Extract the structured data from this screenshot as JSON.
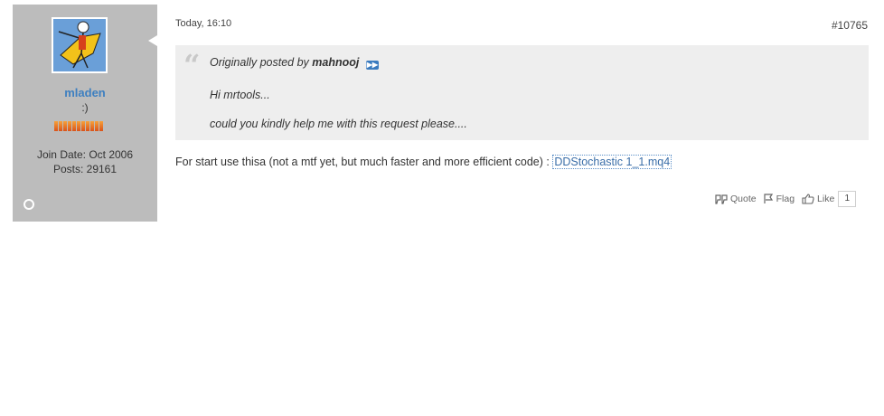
{
  "user": {
    "name": "mladen",
    "title": ":)",
    "join_date": "Join Date: Oct 2006",
    "posts": "Posts: 29161",
    "reputation_bars": 11
  },
  "post": {
    "date": "Today, 16:10",
    "number": "#10765",
    "quote": {
      "prefix": "Originally posted by",
      "author": "mahnooj",
      "lines": [
        "Hi mrtools...",
        "could you kindly help me with this request please...."
      ]
    },
    "body": "For start use thisa (not a mtf yet, but much faster and more efficient code) : ",
    "attachment": "DDStochastic 1_1.mq4"
  },
  "actions": {
    "quote_label": "Quote",
    "flag_label": "Flag",
    "like_label": "Like",
    "like_count": "1"
  },
  "colors": {
    "sidebar_bg": "#bcbcbc",
    "username": "#3d7fc0",
    "quote_bg": "#eeeeee",
    "link": "#3a6ea8"
  }
}
